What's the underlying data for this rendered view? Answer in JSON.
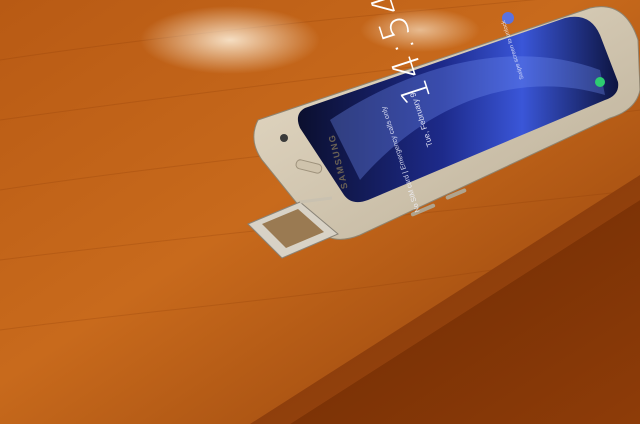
{
  "phone": {
    "brand": "SAMSUNG",
    "time": "14:54",
    "date": "Tue, February 9",
    "status": "No SIM card | Emergency calls only",
    "unlock_hint": "Swipe screen to unlock"
  }
}
